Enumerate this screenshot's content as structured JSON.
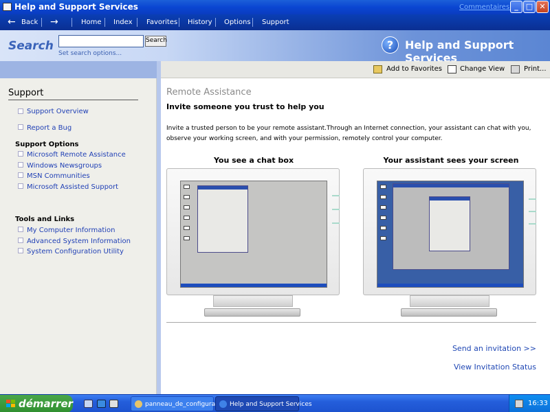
{
  "window": {
    "title": "Help and Support Services",
    "feedback_link": "Commentaires ?",
    "min_glyph": "_",
    "max_glyph": "□",
    "close_glyph": "✕"
  },
  "nav": {
    "back": "Back",
    "items": [
      "Home",
      "Index",
      "Favorites",
      "History",
      "Options",
      "Support"
    ]
  },
  "search": {
    "title": "Search",
    "input_value": "",
    "button": "Search",
    "options_link": "Set search options..."
  },
  "brand": {
    "icon_glyph": "?",
    "title": "Help and Support Services"
  },
  "toolbar": {
    "add_favorites": "Add to Favorites",
    "change_view": "Change View",
    "print": "Print..."
  },
  "sidebar": {
    "heading": "Support",
    "group1": [
      {
        "label": "Support Overview"
      },
      {
        "label": "Report a Bug"
      }
    ],
    "options_heading": "Support Options",
    "group2": [
      {
        "label": "Microsoft Remote Assistance"
      },
      {
        "label": "Windows Newsgroups"
      },
      {
        "label": "MSN Communities"
      },
      {
        "label": "Microsoft Assisted Support"
      }
    ],
    "tools_heading": "Tools and Links",
    "group3": [
      {
        "label": "My Computer Information"
      },
      {
        "label": "Advanced System Information"
      },
      {
        "label": "System Configuration Utility"
      }
    ]
  },
  "main": {
    "heading": "Remote Assistance",
    "subheading": "Invite someone you trust to help you",
    "paragraph": "Invite a trusted person to be your remote assistant.Through an Internet connection, your assistant can chat with you, observe your working screen, and with your permission, remotely control your computer.",
    "caption_left": "You see a chat box",
    "caption_right": "Your assistant sees your screen",
    "send_invitation": "Send an invitation >>",
    "view_status": "View Invitation Status"
  },
  "taskbar": {
    "start": "démarrer",
    "tasks": [
      {
        "label": "panneau_de_configurati...",
        "active": false
      },
      {
        "label": "Help and Support Services",
        "active": true
      }
    ],
    "clock": "16:33"
  }
}
